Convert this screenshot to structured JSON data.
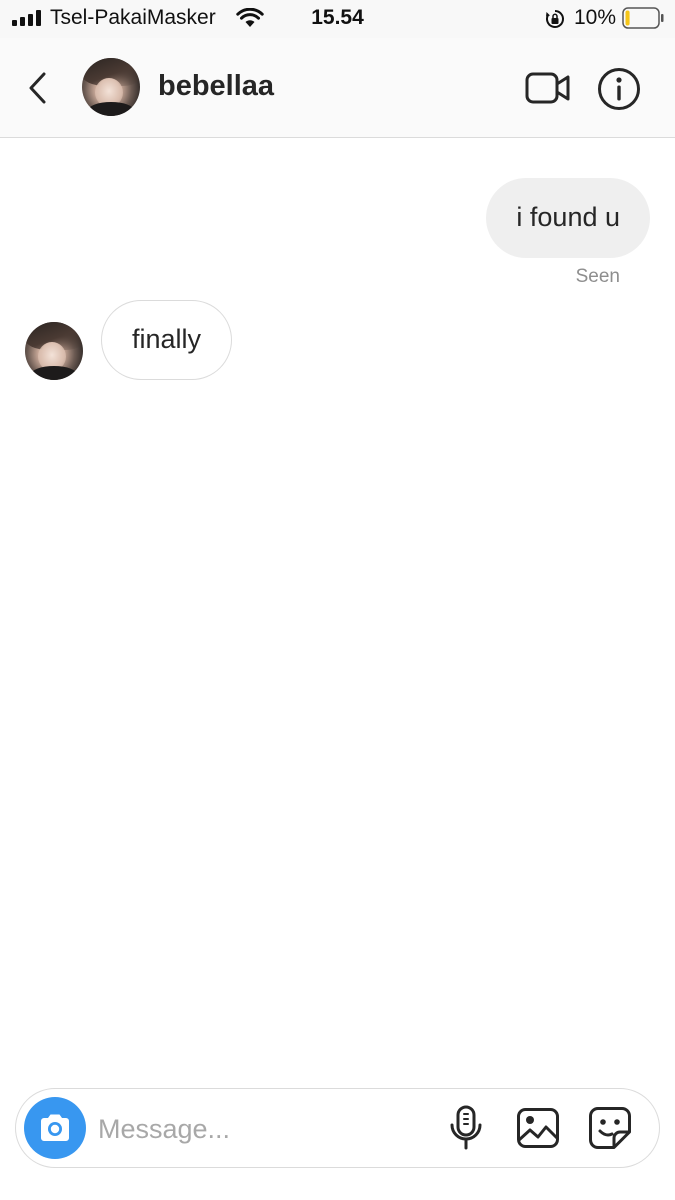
{
  "status_bar": {
    "carrier": "Tsel-PakaiMasker",
    "time": "15.54",
    "battery_percent": "10%",
    "battery_level": 0.1,
    "battery_color": "#f5c518",
    "icons": [
      "signal-icon",
      "wifi-icon",
      "orientation-lock-icon",
      "battery-icon"
    ]
  },
  "header": {
    "username": "bebellaa",
    "icons": [
      "back-chevron-icon",
      "video-camera-icon",
      "info-icon"
    ]
  },
  "messages": [
    {
      "direction": "outgoing",
      "text": "i found u",
      "status": "Seen"
    },
    {
      "direction": "incoming",
      "text": "finally"
    }
  ],
  "composer": {
    "placeholder": "Message...",
    "value": "",
    "camera_color": "#3897f0",
    "icons": [
      "camera-icon",
      "microphone-icon",
      "gallery-icon",
      "sticker-icon"
    ]
  }
}
